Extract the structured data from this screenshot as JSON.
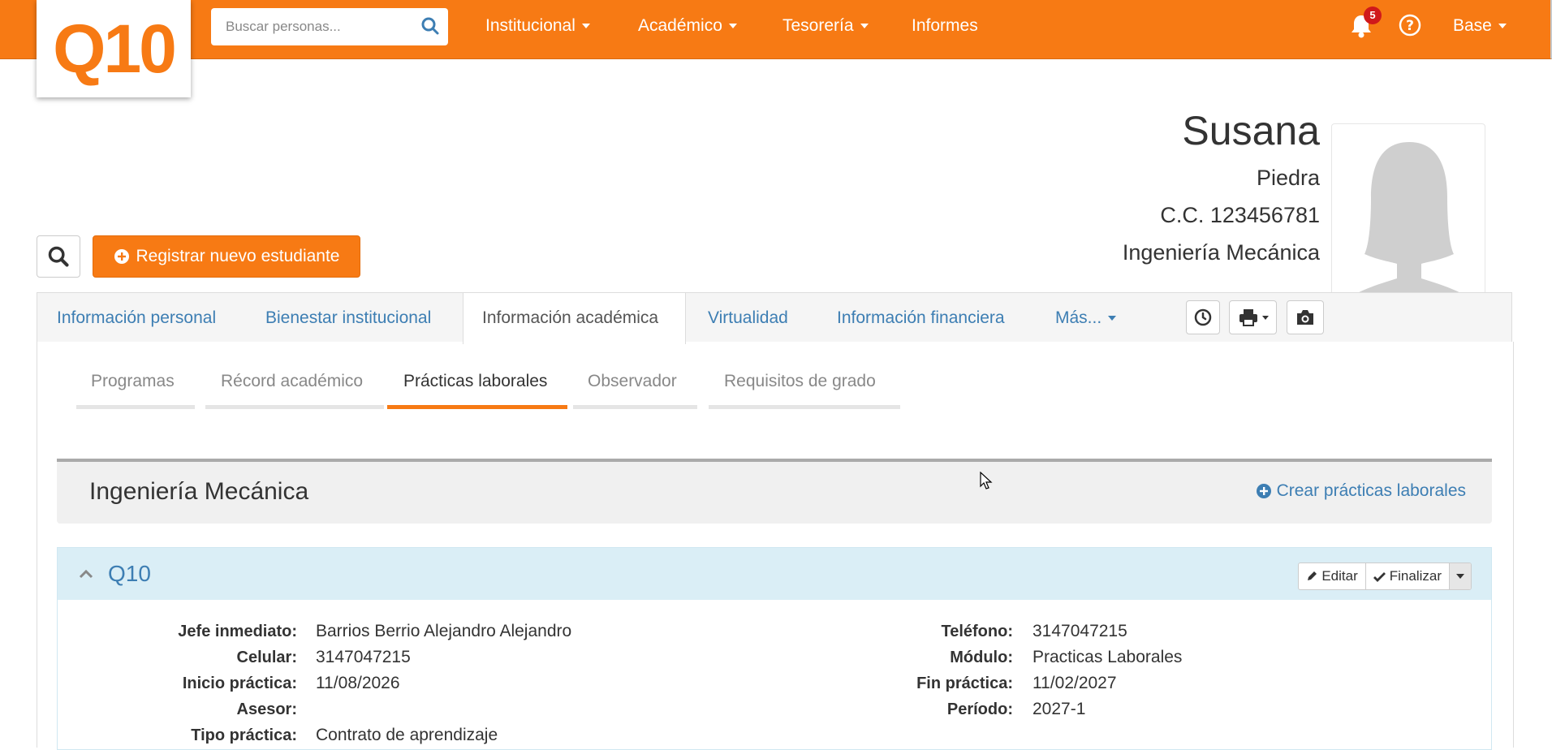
{
  "brand": {
    "logo_text": "Q10",
    "accent": "#f77a14",
    "link": "#3d7eb3"
  },
  "header": {
    "search_placeholder": "Buscar personas...",
    "nav": [
      {
        "label": "Institucional",
        "dropdown": true
      },
      {
        "label": "Académico",
        "dropdown": true
      },
      {
        "label": "Tesorería",
        "dropdown": true
      },
      {
        "label": "Informes",
        "dropdown": false
      }
    ],
    "notifications_count": "5",
    "user_menu": "Base"
  },
  "student": {
    "first_name": "Susana",
    "last_name": "Piedra",
    "document": "C.C. 123456781",
    "program": "Ingeniería Mecánica"
  },
  "actions": {
    "register_label": "Registrar nuevo estudiante"
  },
  "tabs": [
    {
      "label": "Información personal",
      "active": false
    },
    {
      "label": "Bienestar institucional",
      "active": false
    },
    {
      "label": "Información académica",
      "active": true
    },
    {
      "label": "Virtualidad",
      "active": false
    },
    {
      "label": "Información financiera",
      "active": false
    },
    {
      "label": "Más...",
      "active": false,
      "dropdown": true
    }
  ],
  "subtabs": [
    {
      "label": "Programas",
      "active": false
    },
    {
      "label": "Récord académico",
      "active": false
    },
    {
      "label": "Prácticas laborales",
      "active": true
    },
    {
      "label": "Observador",
      "active": false
    },
    {
      "label": "Requisitos de grado",
      "active": false
    }
  ],
  "section": {
    "title": "Ingeniería Mecánica",
    "create_label": "Crear prácticas laborales"
  },
  "practice": {
    "company": "Q10",
    "edit_label": "Editar",
    "finish_label": "Finalizar",
    "left_fields": [
      {
        "label": "Jefe inmediato:",
        "value": "Barrios Berrio Alejandro Alejandro"
      },
      {
        "label": "Celular:",
        "value": "3147047215"
      },
      {
        "label": "Inicio práctica:",
        "value": "11/08/2026"
      },
      {
        "label": "Asesor:",
        "value": ""
      },
      {
        "label": "Tipo práctica:",
        "value": "Contrato de aprendizaje"
      }
    ],
    "right_fields": [
      {
        "label": "Teléfono:",
        "value": "3147047215"
      },
      {
        "label": "Módulo:",
        "value": "Practicas Laborales"
      },
      {
        "label": "Fin práctica:",
        "value": "11/02/2027"
      },
      {
        "label": "Período:",
        "value": "2027-1"
      }
    ]
  }
}
